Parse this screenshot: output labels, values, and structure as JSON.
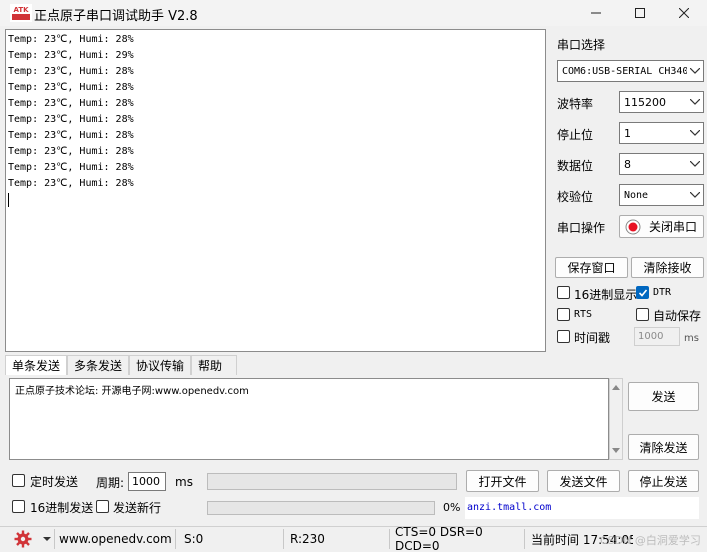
{
  "window": {
    "title": "正点原子串口调试助手 V2.8",
    "logo_text": "ATK"
  },
  "receive": {
    "lines": [
      "Temp: 23℃, Humi: 28%",
      "Temp: 23℃, Humi: 29%",
      "Temp: 23℃, Humi: 28%",
      "Temp: 23℃, Humi: 28%",
      "Temp: 23℃, Humi: 28%",
      "Temp: 23℃, Humi: 28%",
      "Temp: 23℃, Humi: 28%",
      "Temp: 23℃, Humi: 28%",
      "Temp: 23℃, Humi: 28%",
      "Temp: 23℃, Humi: 28%"
    ]
  },
  "settings": {
    "port_select_label": "串口选择",
    "port_value": "COM6:USB-SERIAL CH340",
    "baud_label": "波特率",
    "baud_value": "115200",
    "stop_label": "停止位",
    "stop_value": "1",
    "data_label": "数据位",
    "data_value": "8",
    "parity_label": "校验位",
    "parity_value": "None",
    "port_op_label": "串口操作",
    "close_port_label": "关闭串口",
    "save_window_label": "保存窗口",
    "clear_recv_label": "清除接收",
    "hex_display_label": "16进制显示",
    "dtr_label": "DTR",
    "rts_label": "RTS",
    "auto_save_label": "自动保存",
    "timestamp_label": "时间戳",
    "timestamp_value": "1000",
    "timestamp_unit": "ms"
  },
  "tabs": [
    "单条发送",
    "多条发送",
    "协议传输",
    "帮助"
  ],
  "send": {
    "text": "正点原子技术论坛: 开源电子网:www.openedv.com",
    "send_label": "发送",
    "clear_send_label": "清除发送",
    "timed_send_label": "定时发送",
    "period_label": "周期:",
    "period_value": "1000",
    "period_unit": "ms",
    "open_file_label": "打开文件",
    "send_file_label": "发送文件",
    "stop_send_label": "停止发送",
    "hex_send_label": "16进制发送",
    "send_newline_label": "发送新行",
    "progress_text": "0%",
    "progress": 0,
    "link_text": "anzi.tmall.com"
  },
  "status": {
    "url": "www.openedv.com",
    "sent": "S:0",
    "received": "R:230",
    "lines": "CTS=0 DSR=0 DCD=0",
    "time": "当前时间 17:54:05",
    "watermark": "CSDN @白洞爱学习"
  },
  "colors": {
    "accent": "#0067c0",
    "record_red": "#e81123",
    "gear_red": "#d13438"
  }
}
